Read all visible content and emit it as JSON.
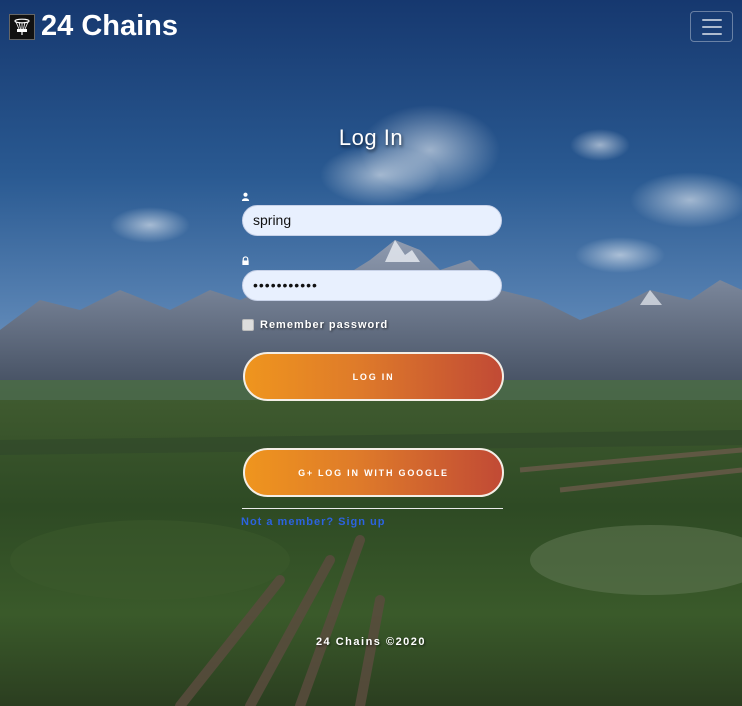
{
  "navbar": {
    "brand": "24 Chains",
    "logo_icon": "disc-golf-basket-icon",
    "menu_icon": "hamburger-menu-icon"
  },
  "login": {
    "title": "Log In",
    "username_icon": "user-icon",
    "username_value": "spring",
    "password_icon": "lock-icon",
    "password_value": "•••••••••••",
    "remember_label": "Remember password",
    "login_button": "LOG IN",
    "google_icon": "google-plus-icon",
    "google_button": "LOG IN WITH GOOGLE",
    "signup_link": "Not a member? Sign up"
  },
  "footer": {
    "text": "24 Chains ©2020"
  },
  "colors": {
    "button_start": "#ef951e",
    "button_end": "#c14a35",
    "link": "#2c63e0",
    "input_bg": "#e8f0fe"
  }
}
